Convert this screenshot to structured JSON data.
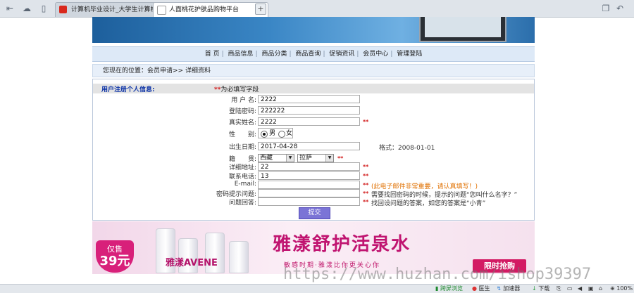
{
  "browser": {
    "tabs": [
      {
        "title": "计算机毕业设计_大学生计算机",
        "active": false,
        "favicon_color": "#d9281c"
      },
      {
        "title": "人面桃花护肤品购物平台",
        "active": true,
        "favicon_color": "#ffffff"
      }
    ],
    "new_tab_label": "+"
  },
  "nav": {
    "items": [
      "首 页",
      "商品信息",
      "商品分类",
      "商品查询",
      "促销资讯",
      "会员中心",
      "管理登陆"
    ],
    "separator": "|"
  },
  "breadcrumb": "您现在的位置：会员申请>> 详细资料",
  "form": {
    "header_title": "用户注册个人信息:",
    "header_required_mark": "**",
    "header_required_note": "为必填写字段",
    "fields": {
      "username": {
        "label": "用 户 名:",
        "value": "2222"
      },
      "password": {
        "label": "登陆密码:",
        "value": "222222"
      },
      "realname": {
        "label": "真实姓名:",
        "value": "2222",
        "star": "**"
      },
      "gender": {
        "label": "性　　别:",
        "options": [
          "男",
          "女"
        ],
        "selected": "男"
      },
      "birthday": {
        "label": "出生日期:",
        "value": "2017-04-28",
        "hint": "格式：2008-01-01"
      },
      "region": {
        "label": "籍　　贯:",
        "province": "西藏",
        "city": "拉萨",
        "star": "**"
      },
      "address": {
        "label": "详细地址:",
        "value": "22",
        "star": "**"
      },
      "phone": {
        "label": "联系电话:",
        "value": "13",
        "star": "**"
      },
      "email": {
        "label": "E-mail:",
        "value": "",
        "star": "**",
        "hint": "(此电子邮件非常重要，请认真填写！)"
      },
      "question": {
        "label": "密码提示问题:",
        "value": "",
        "star": "**",
        "hint": "需要找回密码的时候，提示的问题“您叫什么名字？”"
      },
      "answer": {
        "label": "问题回答:",
        "value": "",
        "star": "**",
        "hint": "找回设问题的答案，如您的答案是“小青”"
      }
    },
    "submit_label": "提交"
  },
  "ad": {
    "price_label": "仅售",
    "price_value": "39元",
    "brand": "雅漾AVENE",
    "slogan": "雅漾舒护活泉水",
    "subtitle": "敏感时期·雅漾比你更关心你",
    "buy_label": "限时抢购"
  },
  "watermark": "https://www.huzhan.com/ishop39397",
  "status_bar": {
    "items": [
      "跨屏浏览",
      "医生",
      "加速器",
      "下载",
      "100%"
    ]
  }
}
